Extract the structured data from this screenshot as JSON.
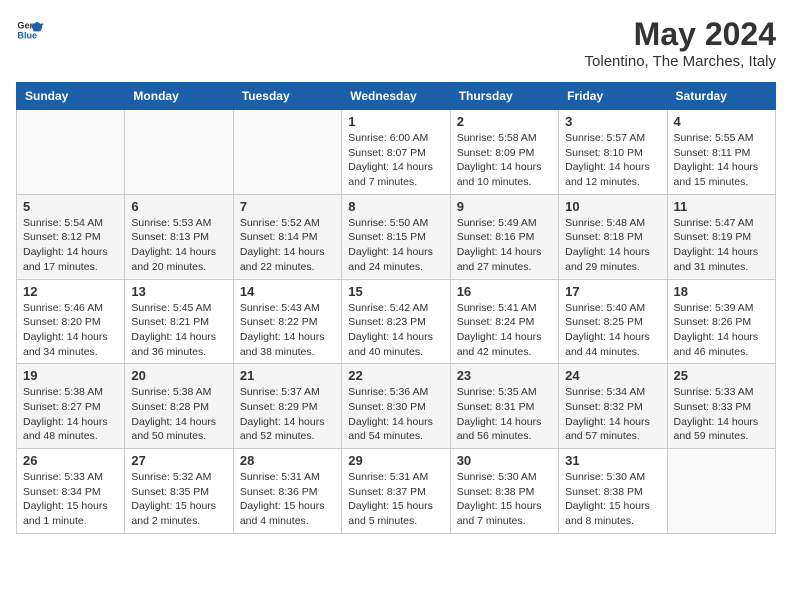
{
  "header": {
    "logo_general": "General",
    "logo_blue": "Blue",
    "month_title": "May 2024",
    "location": "Tolentino, The Marches, Italy"
  },
  "days_of_week": [
    "Sunday",
    "Monday",
    "Tuesday",
    "Wednesday",
    "Thursday",
    "Friday",
    "Saturday"
  ],
  "weeks": [
    [
      {
        "day": "",
        "info": ""
      },
      {
        "day": "",
        "info": ""
      },
      {
        "day": "",
        "info": ""
      },
      {
        "day": "1",
        "info": "Sunrise: 6:00 AM\nSunset: 8:07 PM\nDaylight: 14 hours\nand 7 minutes."
      },
      {
        "day": "2",
        "info": "Sunrise: 5:58 AM\nSunset: 8:09 PM\nDaylight: 14 hours\nand 10 minutes."
      },
      {
        "day": "3",
        "info": "Sunrise: 5:57 AM\nSunset: 8:10 PM\nDaylight: 14 hours\nand 12 minutes."
      },
      {
        "day": "4",
        "info": "Sunrise: 5:55 AM\nSunset: 8:11 PM\nDaylight: 14 hours\nand 15 minutes."
      }
    ],
    [
      {
        "day": "5",
        "info": "Sunrise: 5:54 AM\nSunset: 8:12 PM\nDaylight: 14 hours\nand 17 minutes."
      },
      {
        "day": "6",
        "info": "Sunrise: 5:53 AM\nSunset: 8:13 PM\nDaylight: 14 hours\nand 20 minutes."
      },
      {
        "day": "7",
        "info": "Sunrise: 5:52 AM\nSunset: 8:14 PM\nDaylight: 14 hours\nand 22 minutes."
      },
      {
        "day": "8",
        "info": "Sunrise: 5:50 AM\nSunset: 8:15 PM\nDaylight: 14 hours\nand 24 minutes."
      },
      {
        "day": "9",
        "info": "Sunrise: 5:49 AM\nSunset: 8:16 PM\nDaylight: 14 hours\nand 27 minutes."
      },
      {
        "day": "10",
        "info": "Sunrise: 5:48 AM\nSunset: 8:18 PM\nDaylight: 14 hours\nand 29 minutes."
      },
      {
        "day": "11",
        "info": "Sunrise: 5:47 AM\nSunset: 8:19 PM\nDaylight: 14 hours\nand 31 minutes."
      }
    ],
    [
      {
        "day": "12",
        "info": "Sunrise: 5:46 AM\nSunset: 8:20 PM\nDaylight: 14 hours\nand 34 minutes."
      },
      {
        "day": "13",
        "info": "Sunrise: 5:45 AM\nSunset: 8:21 PM\nDaylight: 14 hours\nand 36 minutes."
      },
      {
        "day": "14",
        "info": "Sunrise: 5:43 AM\nSunset: 8:22 PM\nDaylight: 14 hours\nand 38 minutes."
      },
      {
        "day": "15",
        "info": "Sunrise: 5:42 AM\nSunset: 8:23 PM\nDaylight: 14 hours\nand 40 minutes."
      },
      {
        "day": "16",
        "info": "Sunrise: 5:41 AM\nSunset: 8:24 PM\nDaylight: 14 hours\nand 42 minutes."
      },
      {
        "day": "17",
        "info": "Sunrise: 5:40 AM\nSunset: 8:25 PM\nDaylight: 14 hours\nand 44 minutes."
      },
      {
        "day": "18",
        "info": "Sunrise: 5:39 AM\nSunset: 8:26 PM\nDaylight: 14 hours\nand 46 minutes."
      }
    ],
    [
      {
        "day": "19",
        "info": "Sunrise: 5:38 AM\nSunset: 8:27 PM\nDaylight: 14 hours\nand 48 minutes."
      },
      {
        "day": "20",
        "info": "Sunrise: 5:38 AM\nSunset: 8:28 PM\nDaylight: 14 hours\nand 50 minutes."
      },
      {
        "day": "21",
        "info": "Sunrise: 5:37 AM\nSunset: 8:29 PM\nDaylight: 14 hours\nand 52 minutes."
      },
      {
        "day": "22",
        "info": "Sunrise: 5:36 AM\nSunset: 8:30 PM\nDaylight: 14 hours\nand 54 minutes."
      },
      {
        "day": "23",
        "info": "Sunrise: 5:35 AM\nSunset: 8:31 PM\nDaylight: 14 hours\nand 56 minutes."
      },
      {
        "day": "24",
        "info": "Sunrise: 5:34 AM\nSunset: 8:32 PM\nDaylight: 14 hours\nand 57 minutes."
      },
      {
        "day": "25",
        "info": "Sunrise: 5:33 AM\nSunset: 8:33 PM\nDaylight: 14 hours\nand 59 minutes."
      }
    ],
    [
      {
        "day": "26",
        "info": "Sunrise: 5:33 AM\nSunset: 8:34 PM\nDaylight: 15 hours\nand 1 minute."
      },
      {
        "day": "27",
        "info": "Sunrise: 5:32 AM\nSunset: 8:35 PM\nDaylight: 15 hours\nand 2 minutes."
      },
      {
        "day": "28",
        "info": "Sunrise: 5:31 AM\nSunset: 8:36 PM\nDaylight: 15 hours\nand 4 minutes."
      },
      {
        "day": "29",
        "info": "Sunrise: 5:31 AM\nSunset: 8:37 PM\nDaylight: 15 hours\nand 5 minutes."
      },
      {
        "day": "30",
        "info": "Sunrise: 5:30 AM\nSunset: 8:38 PM\nDaylight: 15 hours\nand 7 minutes."
      },
      {
        "day": "31",
        "info": "Sunrise: 5:30 AM\nSunset: 8:38 PM\nDaylight: 15 hours\nand 8 minutes."
      },
      {
        "day": "",
        "info": ""
      }
    ]
  ]
}
